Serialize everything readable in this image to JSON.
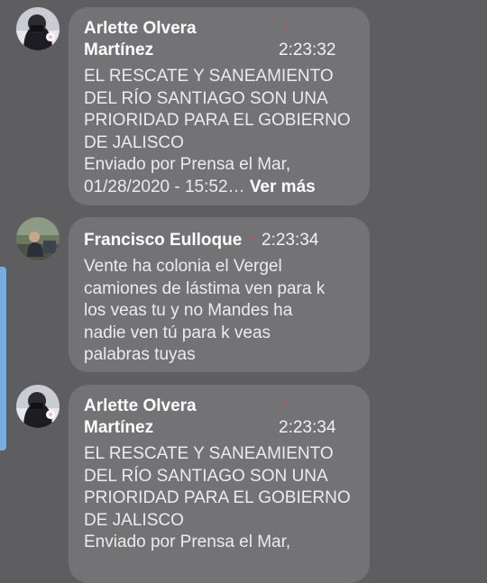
{
  "messages": [
    {
      "author_line1": "Arlette Olvera",
      "author_line2": "Martínez",
      "time": "2:23:32",
      "text": "EL RESCATE Y SANEAMIENTO\nDEL RÍO SANTIAGO SON UNA\nPRIORIDAD PARA EL GOBIERNO\nDE JALISCO\nEnviado por Prensa el Mar,\n01/28/2020 - 15:52…",
      "more_label": "Ver más"
    },
    {
      "author": "Francisco Eulloque",
      "time": "2:23:34",
      "text": "Vente ha colonia el Vergel\ncamiones de lástima ven para k\nlos veas tu y no Mandes  ha\nnadie ven tú para k veas\npalabras tuyas"
    },
    {
      "author_line1": "Arlette Olvera",
      "author_line2": "Martínez",
      "time": "2:23:34",
      "text": "EL RESCATE Y SANEAMIENTO\nDEL RÍO SANTIAGO SON UNA\nPRIORIDAD PARA EL GOBIERNO\nDE JALISCO\nEnviado por Prensa el Mar,"
    }
  ],
  "colors": {
    "background": "#5e5e60",
    "bubble": "#737375",
    "edge_indicator": "#76aee3",
    "presence_dot": "#d94a4a"
  }
}
